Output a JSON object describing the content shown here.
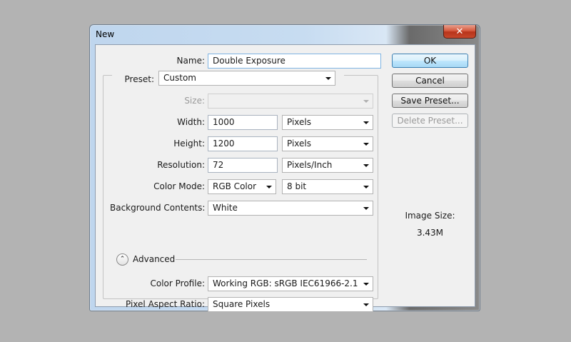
{
  "window": {
    "title": "New",
    "close_glyph": "✕"
  },
  "form": {
    "name_label": "Name:",
    "name_value": "Double Exposure",
    "preset_label": "Preset:",
    "preset_value": "Custom",
    "size_label": "Size:",
    "size_value": "",
    "width_label": "Width:",
    "width_value": "1000",
    "width_unit": "Pixels",
    "height_label": "Height:",
    "height_value": "1200",
    "height_unit": "Pixels",
    "resolution_label": "Resolution:",
    "resolution_value": "72",
    "resolution_unit": "Pixels/Inch",
    "color_mode_label": "Color Mode:",
    "color_mode_value": "RGB Color",
    "bit_depth_value": "8 bit",
    "background_label": "Background Contents:",
    "background_value": "White"
  },
  "advanced": {
    "label": "Advanced",
    "toggle_glyph": "⌃",
    "color_profile_label": "Color Profile:",
    "color_profile_value": "Working RGB:  sRGB IEC61966-2.1",
    "pixel_aspect_label": "Pixel Aspect Ratio:",
    "pixel_aspect_value": "Square Pixels"
  },
  "buttons": {
    "ok": "OK",
    "cancel": "Cancel",
    "save_preset": "Save Preset...",
    "delete_preset": "Delete Preset..."
  },
  "image_size": {
    "label": "Image Size:",
    "value": "3.43M"
  },
  "colors": {
    "default_button": "#bee6fd",
    "close_button": "#c6482c",
    "dialog_bg": "#f0f0f0"
  }
}
